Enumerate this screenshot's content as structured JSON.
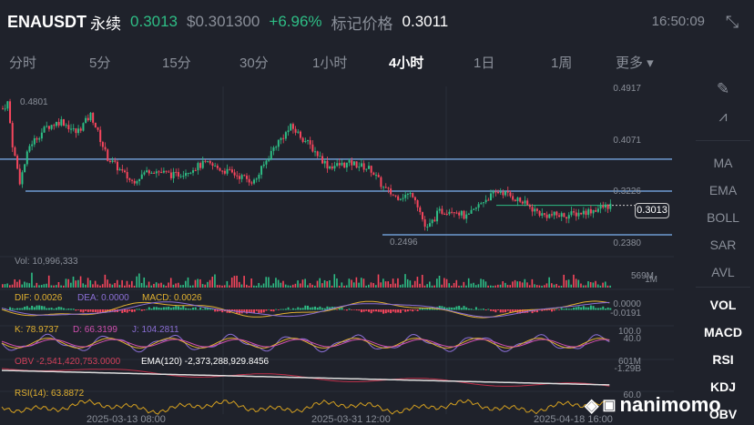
{
  "header": {
    "symbol": "ENAUSDT",
    "contract": "永续",
    "last_price": "0.3013",
    "usd_price": "$0.301300",
    "change": "+6.96%",
    "mark_label": "标记价格",
    "mark_price": "0.3011",
    "time": "16:50:09"
  },
  "tabs": [
    {
      "label": "分时"
    },
    {
      "label": "5分"
    },
    {
      "label": "15分"
    },
    {
      "label": "30分"
    },
    {
      "label": "1小时"
    },
    {
      "label": "4小时",
      "active": true
    },
    {
      "label": "1日"
    },
    {
      "label": "1周"
    },
    {
      "label": "更多 ▾"
    }
  ],
  "sidebar": {
    "tools": [
      "draw-icon",
      "indicator-chart-icon"
    ],
    "main": [
      "MA",
      "EMA",
      "BOLL",
      "SAR",
      "AVL"
    ],
    "sub": [
      "VOL",
      "MACD",
      "RSI",
      "KDJ",
      "OBV"
    ]
  },
  "chart_data": {
    "type": "candlestick",
    "price_axis": [
      "0.4917",
      "0.4071",
      "0.3226",
      "0.2380"
    ],
    "high_label": "0.4801",
    "low_label": "0.2496",
    "current_price": "0.3013",
    "horizontal_lines": [
      0.377,
      0.3246,
      0.253
    ],
    "price_path": [
      [
        0,
        0.46
      ],
      [
        4,
        0.47
      ],
      [
        8,
        0.4
      ],
      [
        14,
        0.34
      ],
      [
        22,
        0.4
      ],
      [
        36,
        0.43
      ],
      [
        48,
        0.44
      ],
      [
        60,
        0.42
      ],
      [
        72,
        0.45
      ],
      [
        85,
        0.38
      ],
      [
        105,
        0.34
      ],
      [
        120,
        0.36
      ],
      [
        140,
        0.35
      ],
      [
        165,
        0.37
      ],
      [
        185,
        0.355
      ],
      [
        205,
        0.34
      ],
      [
        222,
        0.4
      ],
      [
        235,
        0.43
      ],
      [
        250,
        0.4
      ],
      [
        265,
        0.365
      ],
      [
        285,
        0.37
      ],
      [
        300,
        0.36
      ],
      [
        310,
        0.33
      ],
      [
        320,
        0.315
      ],
      [
        335,
        0.32
      ],
      [
        345,
        0.26
      ],
      [
        355,
        0.29
      ],
      [
        368,
        0.295
      ],
      [
        378,
        0.28
      ],
      [
        392,
        0.31
      ],
      [
        405,
        0.325
      ],
      [
        420,
        0.31
      ],
      [
        440,
        0.285
      ],
      [
        460,
        0.285
      ],
      [
        480,
        0.293
      ],
      [
        495,
        0.3013
      ]
    ],
    "dates": [
      "2025-03-13 08:00",
      "2025-03-31 12:00",
      "2025-04-18 16:00"
    ],
    "volume": {
      "label": "Vol: 10,996,333",
      "axis": [
        "569M",
        "1M"
      ]
    },
    "macd": {
      "dif": "DIF: 0.0026",
      "dea": "DEA: 0.0000",
      "macd": "MACD: 0.0026",
      "axis": [
        "0.0000",
        "-0.0191"
      ]
    },
    "kdj": {
      "k": "K: 78.9737",
      "d": "D: 66.3199",
      "j": "J: 104.2811",
      "axis": [
        "100.0",
        "40.0"
      ]
    },
    "obv": {
      "obv": "OBV -2,541,420,753.0000",
      "ema": "EMA(120) -2,373,288,929.8456",
      "axis": [
        "601M",
        "-1.29B"
      ]
    },
    "rsi": {
      "rsi": "RSI(14): 63.8872",
      "axis": [
        "60.0"
      ]
    }
  },
  "watermark": "nanimomo",
  "colors": {
    "up": "#2ebd85",
    "down": "#f6465d",
    "line": "#6f9bd1"
  }
}
